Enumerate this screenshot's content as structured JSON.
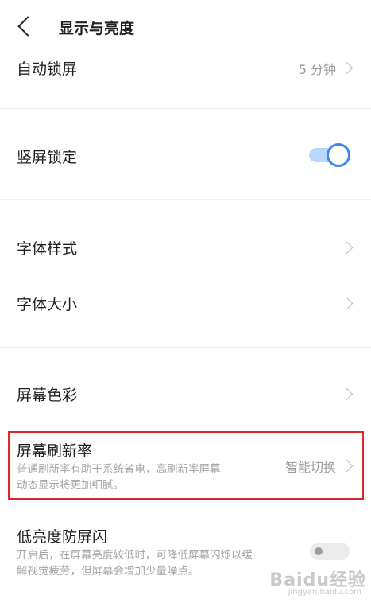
{
  "header": {
    "title": "显示与亮度"
  },
  "rows": {
    "auto_lock": {
      "label": "自动锁屏",
      "value": "5 分钟"
    },
    "portrait_lock": {
      "label": "竖屏锁定",
      "enabled": true
    },
    "font_style": {
      "label": "字体样式"
    },
    "font_size": {
      "label": "字体大小"
    },
    "screen_color": {
      "label": "屏幕色彩"
    },
    "refresh_rate": {
      "label": "屏幕刷新率",
      "desc_line1": "普通刷新率有助于系统省电，高刷新率屏幕",
      "desc_line2": "动态显示将更加细腻。",
      "value": "智能切换"
    },
    "anti_flicker": {
      "label": "低亮度防屏闪",
      "desc_line1": "开启后，在屏幕亮度较低时，可降低屏幕闪烁以缓",
      "desc_line2": "解视觉疲劳，但屏幕会增加少量噪点。",
      "enabled": false
    }
  },
  "watermark": {
    "logo": "Baidu经验",
    "url": "jingyan.baidu.com"
  },
  "colors": {
    "accent": "#3d86f5",
    "highlight_border": "#e0242a"
  }
}
